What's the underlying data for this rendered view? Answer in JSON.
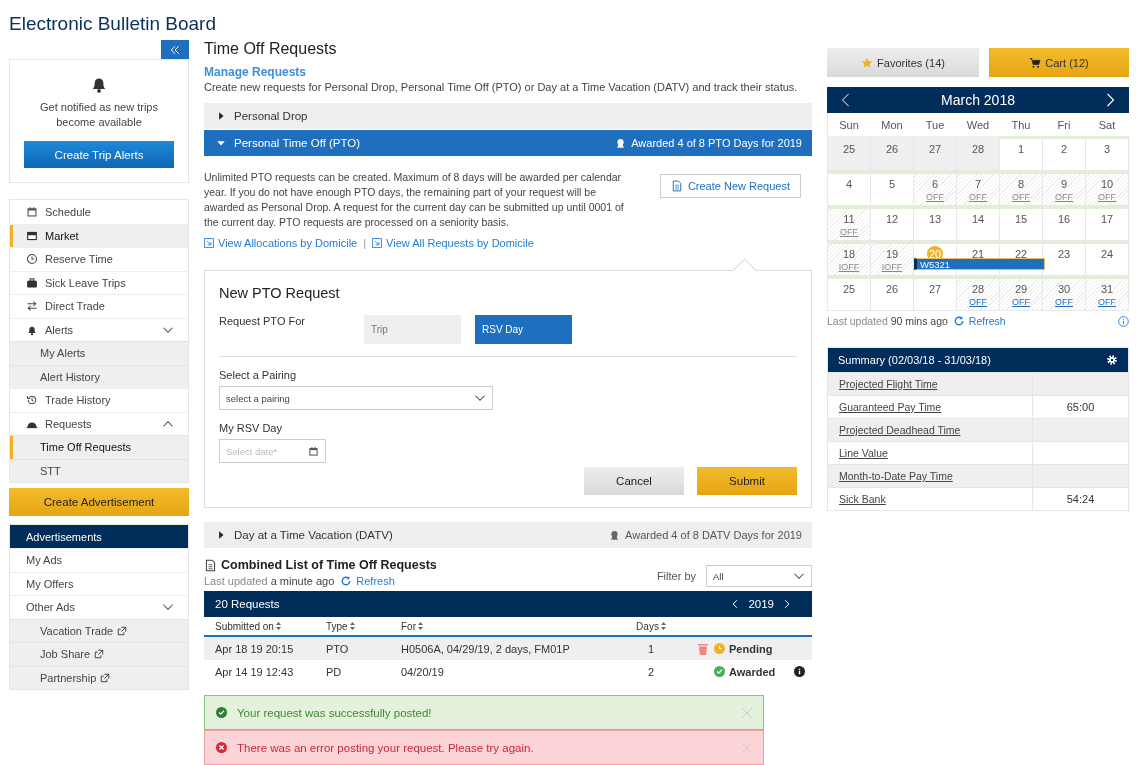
{
  "app_title": "Electronic Bulletin Board",
  "sidebar": {
    "alert_card": {
      "text": "Get notified as new trips become available",
      "button": "Create Trip Alerts"
    },
    "nav": [
      {
        "label": "Schedule",
        "selected": false
      },
      {
        "label": "Market",
        "selected": true
      },
      {
        "label": "Reserve Time",
        "selected": false
      },
      {
        "label": "Sick Leave Trips",
        "selected": false
      },
      {
        "label": "Direct Trade",
        "selected": false
      },
      {
        "label": "Alerts",
        "selected": false,
        "expanded": false,
        "children": [
          {
            "label": "My Alerts",
            "selected": false
          },
          {
            "label": "Alert History",
            "selected": false
          }
        ]
      },
      {
        "label": "Trade History",
        "selected": false
      },
      {
        "label": "Requests",
        "selected": false,
        "expanded": true,
        "children": [
          {
            "label": "Time Off Requests",
            "selected": true
          },
          {
            "label": "STT",
            "selected": false
          }
        ]
      }
    ],
    "ad_button": "Create Advertisement",
    "ads": {
      "title": "Advertisements",
      "items": [
        {
          "label": "My Ads"
        },
        {
          "label": "My Offers"
        },
        {
          "label": "Other Ads",
          "expanded": false,
          "children": [
            {
              "label": "Vacation Trade",
              "external": true
            },
            {
              "label": "Job Share",
              "external": true
            },
            {
              "label": "Partnership",
              "external": true
            }
          ]
        }
      ]
    }
  },
  "main": {
    "title": "Time Off Requests",
    "subtitle": "Manage Requests",
    "description": "Create new requests for Personal Drop, Personal Time Off (PTO) or Day at a Time Vacation (DATV) and track their status.",
    "sections": [
      {
        "title": "Personal Drop",
        "expanded": false
      },
      {
        "title": "Personal Time Off (PTO)",
        "expanded": true,
        "award": "Awarded 4 of 8 PTO Days for 2019"
      },
      {
        "title": "Day at a Time Vacation (DATV)",
        "expanded": false,
        "award": "Awarded 4 of 8 DATV Days for 2019"
      }
    ],
    "pto": {
      "info": "Unlimited PTO requests can be created. Maximum of 8 days will be awarded per calendar year. If you do not have enough PTO days, the remaining part of your request will be awarded as Personal Drop. A request for the current day can be submitted up until 0001 of the current day. PTO requests are processed on a seniority basis.",
      "create_button": "Create New Request",
      "links": [
        "View Allocations by Domicile",
        "View All Requests by Domicile"
      ],
      "separator": "|",
      "form": {
        "title": "New PTO Request",
        "request_for_label": "Request PTO For",
        "options": [
          {
            "label": "Trip",
            "selected": false
          },
          {
            "label": "RSV Day",
            "selected": true
          }
        ],
        "pairing_label": "Select a Pairing",
        "pairing_placeholder": "select a pairing",
        "rsv_label": "My RSV Day",
        "date_placeholder": "Select date*",
        "cancel": "Cancel",
        "submit": "Submit"
      }
    },
    "requests": {
      "title": "Combined List of Time Off Requests",
      "updated_label": "Last updated",
      "updated_value": "a minute ago",
      "refresh": "Refresh",
      "filter_label": "Filter by",
      "filter_value": "All",
      "count": "20 Requests",
      "year": "2019",
      "columns": [
        "Submitted on",
        "Type",
        "For",
        "Days"
      ],
      "rows": [
        {
          "submitted": "Apr 18 19 20:15",
          "type": "PTO",
          "for": "H0506A, 04/29/19, 2 days, FM01P",
          "days": "1",
          "status": "Pending",
          "kind": "pending",
          "deletable": true,
          "info": false
        },
        {
          "submitted": "Apr 14 19 12:43",
          "type": "PD",
          "for": "04/20/19",
          "days": "2",
          "status": "Awarded",
          "kind": "awarded",
          "deletable": false,
          "info": true
        }
      ]
    },
    "toasts": [
      {
        "kind": "success",
        "message": "Your request was successfully posted!"
      },
      {
        "kind": "error",
        "message": "There was an error posting your request. Please try again."
      }
    ]
  },
  "right": {
    "favorites": "Favorites (14)",
    "cart": "Cart (12)",
    "calendar": {
      "month": "March 2018",
      "weekdays": [
        "Sun",
        "Mon",
        "Tue",
        "Wed",
        "Thu",
        "Fri",
        "Sat"
      ],
      "weeks": [
        [
          {
            "day": "25",
            "outside": true,
            "hatched": false,
            "today": false
          },
          {
            "day": "26",
            "outside": true,
            "hatched": false,
            "today": false
          },
          {
            "day": "27",
            "outside": true,
            "hatched": false,
            "today": false
          },
          {
            "day": "28",
            "outside": true,
            "hatched": false,
            "today": false
          },
          {
            "day": "1",
            "outside": false,
            "hatched": false,
            "today": false
          },
          {
            "day": "2",
            "outside": false,
            "hatched": false,
            "today": false
          },
          {
            "day": "3",
            "outside": false,
            "hatched": false,
            "today": false
          }
        ],
        [
          {
            "day": "4",
            "outside": false,
            "hatched": false,
            "today": false
          },
          {
            "day": "5",
            "outside": false,
            "hatched": false,
            "today": false
          },
          {
            "day": "6",
            "outside": false,
            "hatched": true,
            "today": false,
            "off": "OFF",
            "off_link": false
          },
          {
            "day": "7",
            "outside": false,
            "hatched": true,
            "today": false,
            "off": "OFF",
            "off_link": false
          },
          {
            "day": "8",
            "outside": false,
            "hatched": true,
            "today": false,
            "off": "OFF",
            "off_link": false
          },
          {
            "day": "9",
            "outside": false,
            "hatched": true,
            "today": false,
            "off": "OFF",
            "off_link": false
          },
          {
            "day": "10",
            "outside": false,
            "hatched": true,
            "today": false,
            "off": "OFF",
            "off_link": false
          }
        ],
        [
          {
            "day": "11",
            "outside": false,
            "hatched": true,
            "today": false,
            "off": "OFF",
            "off_link": false
          },
          {
            "day": "12",
            "outside": false,
            "hatched": false,
            "today": false
          },
          {
            "day": "13",
            "outside": false,
            "hatched": false,
            "today": false
          },
          {
            "day": "14",
            "outside": false,
            "hatched": false,
            "today": false
          },
          {
            "day": "15",
            "outside": false,
            "hatched": false,
            "today": false
          },
          {
            "day": "16",
            "outside": false,
            "hatched": false,
            "today": false
          },
          {
            "day": "17",
            "outside": false,
            "hatched": false,
            "today": false
          }
        ],
        [
          {
            "day": "18",
            "outside": false,
            "hatched": true,
            "today": false,
            "off": "IOFF",
            "off_link": false
          },
          {
            "day": "19",
            "outside": false,
            "hatched": true,
            "today": false,
            "off": "IOFF",
            "off_link": false
          },
          {
            "day": "20",
            "outside": false,
            "hatched": false,
            "today": true,
            "trip": "W5321"
          },
          {
            "day": "21",
            "outside": false,
            "hatched": false,
            "today": false,
            "trip_continues": true
          },
          {
            "day": "22",
            "outside": false,
            "hatched": false,
            "today": false,
            "trip_continues": true
          },
          {
            "day": "23",
            "outside": false,
            "hatched": false,
            "today": false
          },
          {
            "day": "24",
            "outside": false,
            "hatched": false,
            "today": false
          }
        ],
        [
          {
            "day": "25",
            "outside": false,
            "hatched": false,
            "today": false
          },
          {
            "day": "26",
            "outside": false,
            "hatched": false,
            "today": false
          },
          {
            "day": "27",
            "outside": false,
            "hatched": false,
            "today": false
          },
          {
            "day": "28",
            "outside": false,
            "hatched": true,
            "today": false,
            "off": "OFF",
            "off_link": true
          },
          {
            "day": "29",
            "outside": false,
            "hatched": true,
            "today": false,
            "off": "OFF",
            "off_link": true
          },
          {
            "day": "30",
            "outside": false,
            "hatched": true,
            "today": false,
            "off": "OFF",
            "off_link": true
          },
          {
            "day": "31",
            "outside": false,
            "hatched": true,
            "today": false,
            "off": "OFF",
            "off_link": true
          }
        ]
      ],
      "updated_label": "Last updated",
      "updated_value": "90 mins ago",
      "refresh": "Refresh"
    },
    "summary": {
      "title": "Summary (02/03/18 - 31/03/18)",
      "rows": [
        {
          "label": "Projected Flight Time"
        },
        {
          "label": "Guaranteed Pay Time",
          "value": "65:00"
        },
        {
          "label": "Projected Deadhead Time"
        },
        {
          "label": "Line Value"
        },
        {
          "label": "Month-to-Date Pay Time"
        },
        {
          "label": "Sick Bank",
          "value": "54:24"
        }
      ]
    }
  }
}
